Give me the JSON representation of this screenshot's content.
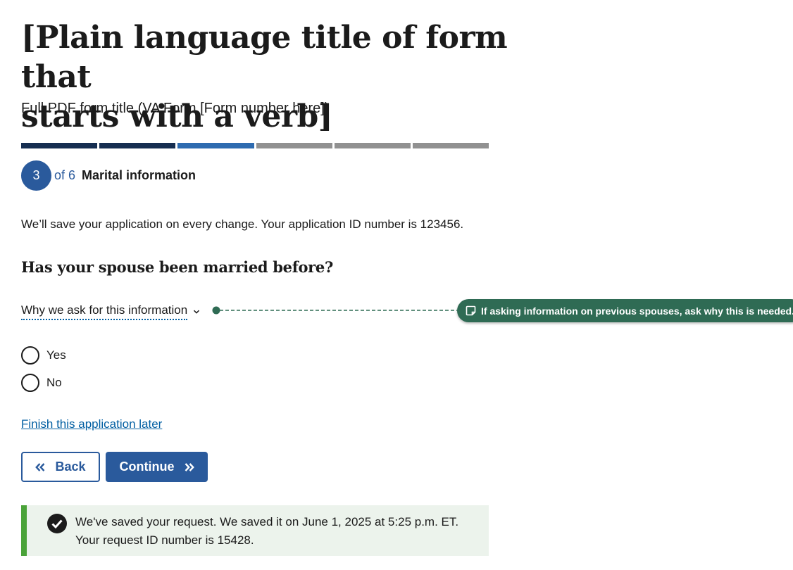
{
  "page": {
    "title_line1": "[Plain language title of form that",
    "title_line2": "starts with a verb]",
    "subtitle": "Full PDF form title (VA Form [Form number here])"
  },
  "progress": {
    "current_step": "3",
    "of_text": "of 6",
    "step_name": "Marital information",
    "total_segments": 6,
    "completed_segments": 3,
    "colors": {
      "done": "#162e51",
      "current": "#2e6bb0",
      "todo": "#919191"
    }
  },
  "save_note": "We’ll save your application on every change. Your application ID number is 123456.",
  "question": {
    "text": "Has your spouse been married before?",
    "why_label": "Why we ask for this information",
    "options": [
      "Yes",
      "No"
    ]
  },
  "annotation": {
    "text": "If asking information on previous spouses, ask why this is needed.",
    "icon": "note-icon",
    "color": "#2f6b54"
  },
  "finish_link": "Finish this application later",
  "buttons": {
    "back": "Back",
    "continue": "Continue"
  },
  "alert": {
    "line1": "We've saved your request. We saved it on June 1, 2025 at 5:25 p.m. ET.",
    "line2": "Your request ID number is 15428.",
    "icon": "check-circle-icon",
    "accent": "#4aa339"
  }
}
